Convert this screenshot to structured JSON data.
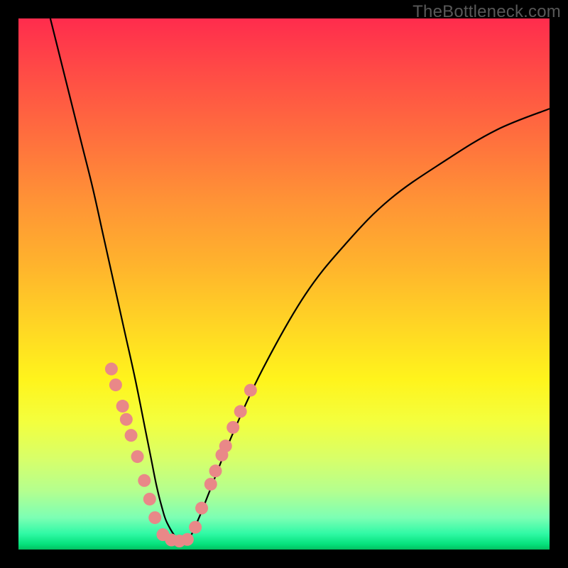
{
  "watermark": "TheBottleneck.com",
  "chart_data": {
    "type": "line",
    "title": "",
    "xlabel": "",
    "ylabel": "",
    "xlim": [
      0,
      100
    ],
    "ylim": [
      0,
      100
    ],
    "grid": false,
    "legend": false,
    "series": [
      {
        "name": "bottleneck-curve",
        "color": "#000000",
        "x": [
          6,
          8,
          10,
          12,
          14,
          16,
          18,
          20,
          22,
          24,
          25,
          26,
          27,
          28,
          30,
          32,
          34,
          36,
          40,
          46,
          54,
          62,
          70,
          80,
          90,
          100
        ],
        "y": [
          100,
          92,
          84,
          76,
          68,
          59,
          50,
          41,
          32,
          22,
          17,
          12,
          8,
          5,
          2,
          2,
          6,
          11,
          21,
          34,
          48,
          58,
          66,
          73,
          79,
          83
        ]
      }
    ],
    "markers": [
      {
        "name": "data-dots",
        "color": "#e98888",
        "radius_px": 9,
        "points": [
          {
            "x": 17.5,
            "y": 34
          },
          {
            "x": 18.3,
            "y": 31
          },
          {
            "x": 19.6,
            "y": 27
          },
          {
            "x": 20.3,
            "y": 24.5
          },
          {
            "x": 21.2,
            "y": 21.5
          },
          {
            "x": 22.4,
            "y": 17.5
          },
          {
            "x": 23.7,
            "y": 13
          },
          {
            "x": 24.7,
            "y": 9.5
          },
          {
            "x": 25.7,
            "y": 6
          },
          {
            "x": 27.2,
            "y": 2.8
          },
          {
            "x": 28.8,
            "y": 1.8
          },
          {
            "x": 30.3,
            "y": 1.6
          },
          {
            "x": 31.8,
            "y": 1.9
          },
          {
            "x": 33.3,
            "y": 4.2
          },
          {
            "x": 34.5,
            "y": 7.8
          },
          {
            "x": 36.2,
            "y": 12.3
          },
          {
            "x": 37.1,
            "y": 14.8
          },
          {
            "x": 38.3,
            "y": 17.8
          },
          {
            "x": 39.0,
            "y": 19.5
          },
          {
            "x": 40.4,
            "y": 23
          },
          {
            "x": 41.8,
            "y": 26
          },
          {
            "x": 43.7,
            "y": 30
          }
        ]
      }
    ]
  }
}
